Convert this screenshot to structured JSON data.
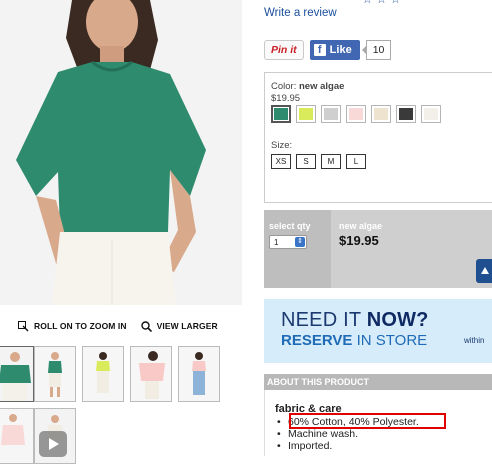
{
  "review_link": "Write a review",
  "social": {
    "pin": "Pin it",
    "like": "Like",
    "like_count": "10"
  },
  "options": {
    "color_label": "Color:",
    "color_name": "new algae",
    "price": "$19.95",
    "swatch_colors": [
      "#2e8b6e",
      "#d9ea5a",
      "#cfcfcf",
      "#f9d9d8",
      "#ede3cf",
      "#3a3a3a",
      "#f3f0ea"
    ],
    "size_label": "Size:",
    "sizes": [
      "XS",
      "S",
      "M",
      "L"
    ]
  },
  "buy": {
    "qty_label": "select qty",
    "qty_value": "1",
    "color_name": "new algae",
    "price": "$19.95"
  },
  "zoom": {
    "roll_label": "ROLL ON TO ZOOM IN",
    "view_label": "VIEW LARGER"
  },
  "banner": {
    "line1_a": "NEED IT",
    "line1_b": "NOW?",
    "line2_a": "RESERVE",
    "line2_b": "IN STORE",
    "line3": "within"
  },
  "about": {
    "header": "ABOUT THIS PRODUCT",
    "section": "fabric & care",
    "items": [
      "60% Cotton, 40% Polyester.",
      "Machine wash.",
      "Imported."
    ]
  },
  "colors": {
    "link": "#1a4f9c",
    "highlight": "#e00000",
    "shirt": "#2e8b6e"
  }
}
